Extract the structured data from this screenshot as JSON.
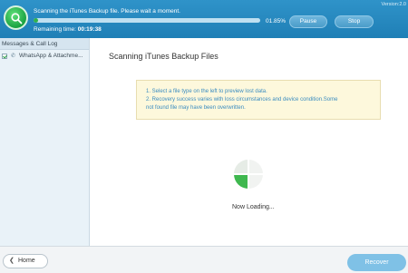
{
  "header": {
    "status": "Scanning the iTunes Backup file. Please wait a moment.",
    "progress_percent": 1.85,
    "progress_label": "01.85%",
    "remaining_label": "Remaining time:",
    "remaining_time": "00:19:38",
    "pause_label": "Pause",
    "stop_label": "Stop",
    "version": "Version:2.0"
  },
  "sidebar": {
    "header": "Messages & Call Log",
    "items": [
      {
        "label": "WhatsApp & Attachme...",
        "checked": true
      }
    ]
  },
  "main": {
    "title": "Scanning iTunes Backup Files",
    "info_lines": [
      "1. Select a file type on the left to preview lost data.",
      "2. Recovery success varies with loss circumstances and device condition.Some",
      "not found file may have been overwritten."
    ],
    "loading_text": "Now Loading..."
  },
  "footer": {
    "home_label": "Home",
    "recover_label": "Recover"
  },
  "colors": {
    "topbar": "#2388bf",
    "progress": "#2fb04c",
    "info_text": "#3a8cc0",
    "recover_button": "#7fc1e6"
  }
}
